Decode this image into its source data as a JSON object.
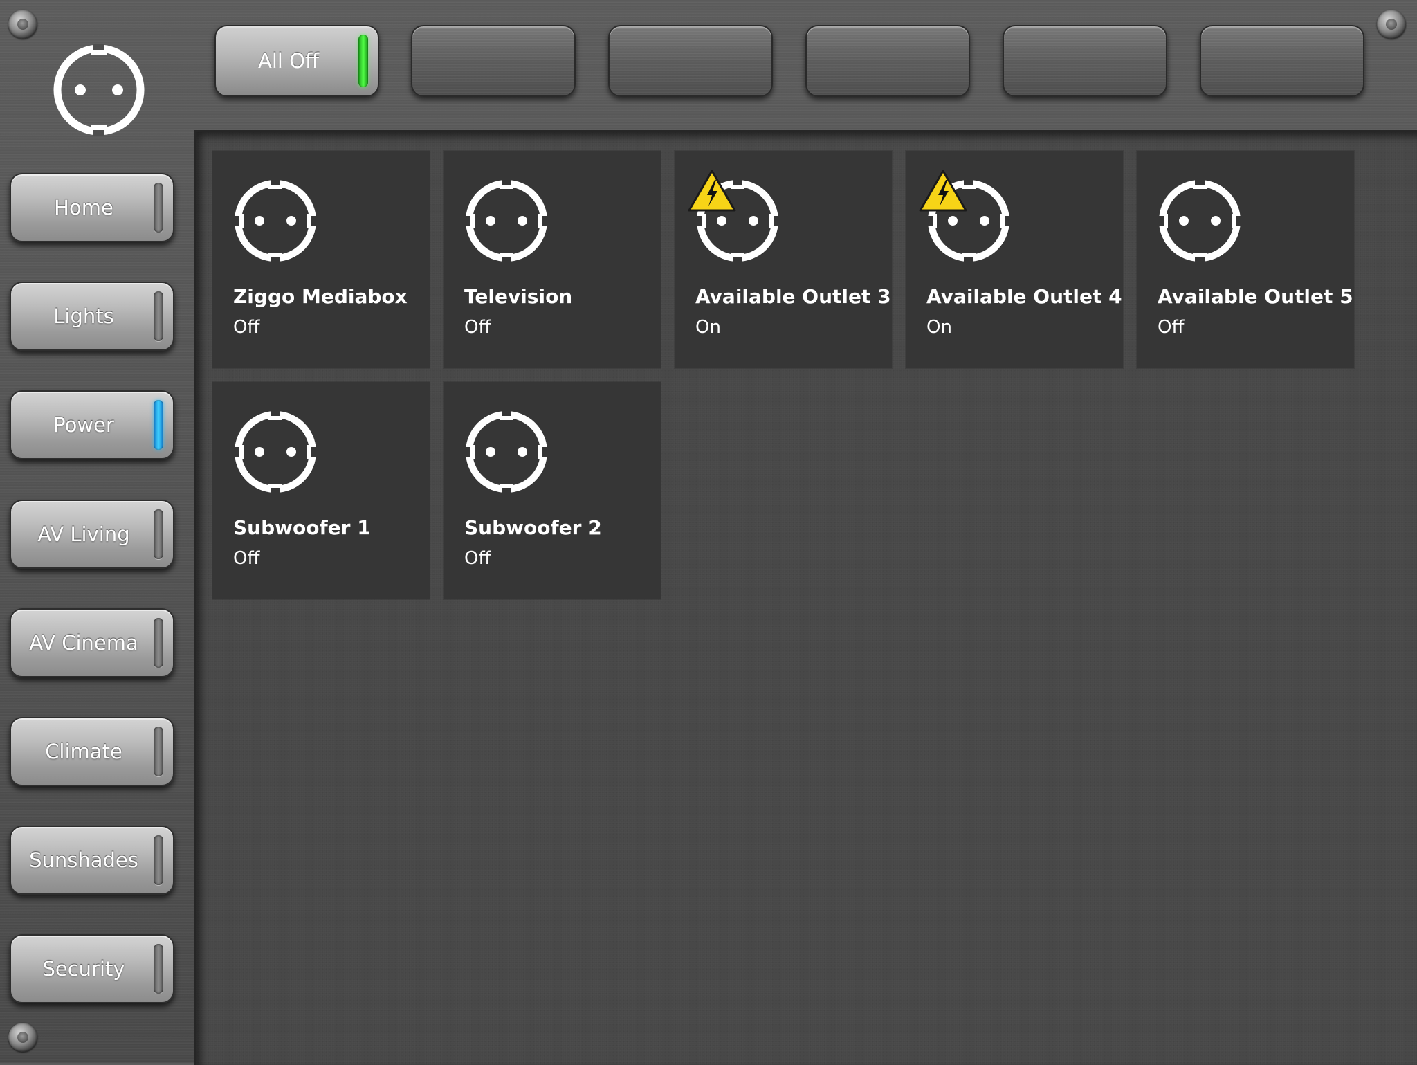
{
  "app": {
    "page_icon": "power-outlet-icon"
  },
  "topbar": {
    "buttons": [
      {
        "label": "All Off",
        "indicator": "green"
      },
      {
        "label": ""
      },
      {
        "label": ""
      },
      {
        "label": ""
      },
      {
        "label": ""
      },
      {
        "label": ""
      }
    ]
  },
  "sidebar": {
    "items": [
      {
        "label": "Home",
        "active": false
      },
      {
        "label": "Lights",
        "active": false
      },
      {
        "label": "Power",
        "active": true
      },
      {
        "label": "AV Living",
        "active": false
      },
      {
        "label": "AV Cinema",
        "active": false
      },
      {
        "label": "Climate",
        "active": false
      },
      {
        "label": "Sunshades",
        "active": false
      },
      {
        "label": "Security",
        "active": false
      }
    ]
  },
  "outlets": [
    {
      "name": "Ziggo Mediabox",
      "status": "Off",
      "warning": false
    },
    {
      "name": "Television",
      "status": "Off",
      "warning": false
    },
    {
      "name": "Available Outlet 3",
      "status": "On",
      "warning": true
    },
    {
      "name": "Available Outlet 4",
      "status": "On",
      "warning": true
    },
    {
      "name": "Available Outlet 5",
      "status": "Off",
      "warning": false
    },
    {
      "name": "Subwoofer 1",
      "status": "Off",
      "warning": false
    },
    {
      "name": "Subwoofer 2",
      "status": "Off",
      "warning": false
    }
  ],
  "colors": {
    "active_indicator": "#3fd0ff",
    "all_off_indicator": "#52ff46",
    "warning": "#f7d417"
  }
}
